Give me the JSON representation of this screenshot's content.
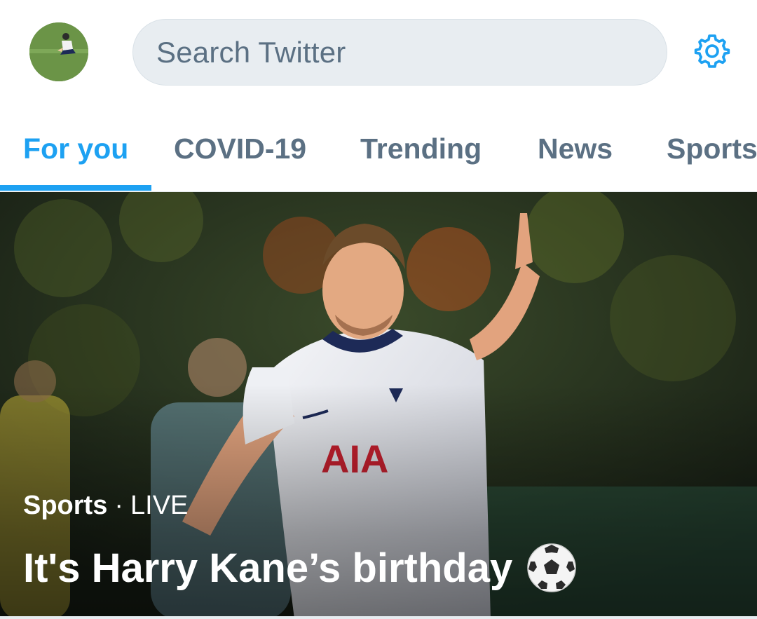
{
  "header": {
    "avatar_icon": "profile-avatar",
    "search_placeholder": "Search Twitter",
    "settings_icon": "gear-icon"
  },
  "tabs": [
    {
      "label": "For you",
      "active": true
    },
    {
      "label": "COVID-19",
      "active": false
    },
    {
      "label": "Trending",
      "active": false
    },
    {
      "label": "News",
      "active": false
    },
    {
      "label": "Sports",
      "active": false
    }
  ],
  "hero": {
    "category": "Sports",
    "separator": "·",
    "status": "LIVE",
    "title": "It's Harry Kane’s birthday",
    "emoji_icon": "soccer-ball-icon",
    "image_icon": "hero-photo"
  },
  "colors": {
    "accent": "#1da1f2",
    "tab_inactive": "#5b7083",
    "search_bg": "#e8edf1"
  }
}
